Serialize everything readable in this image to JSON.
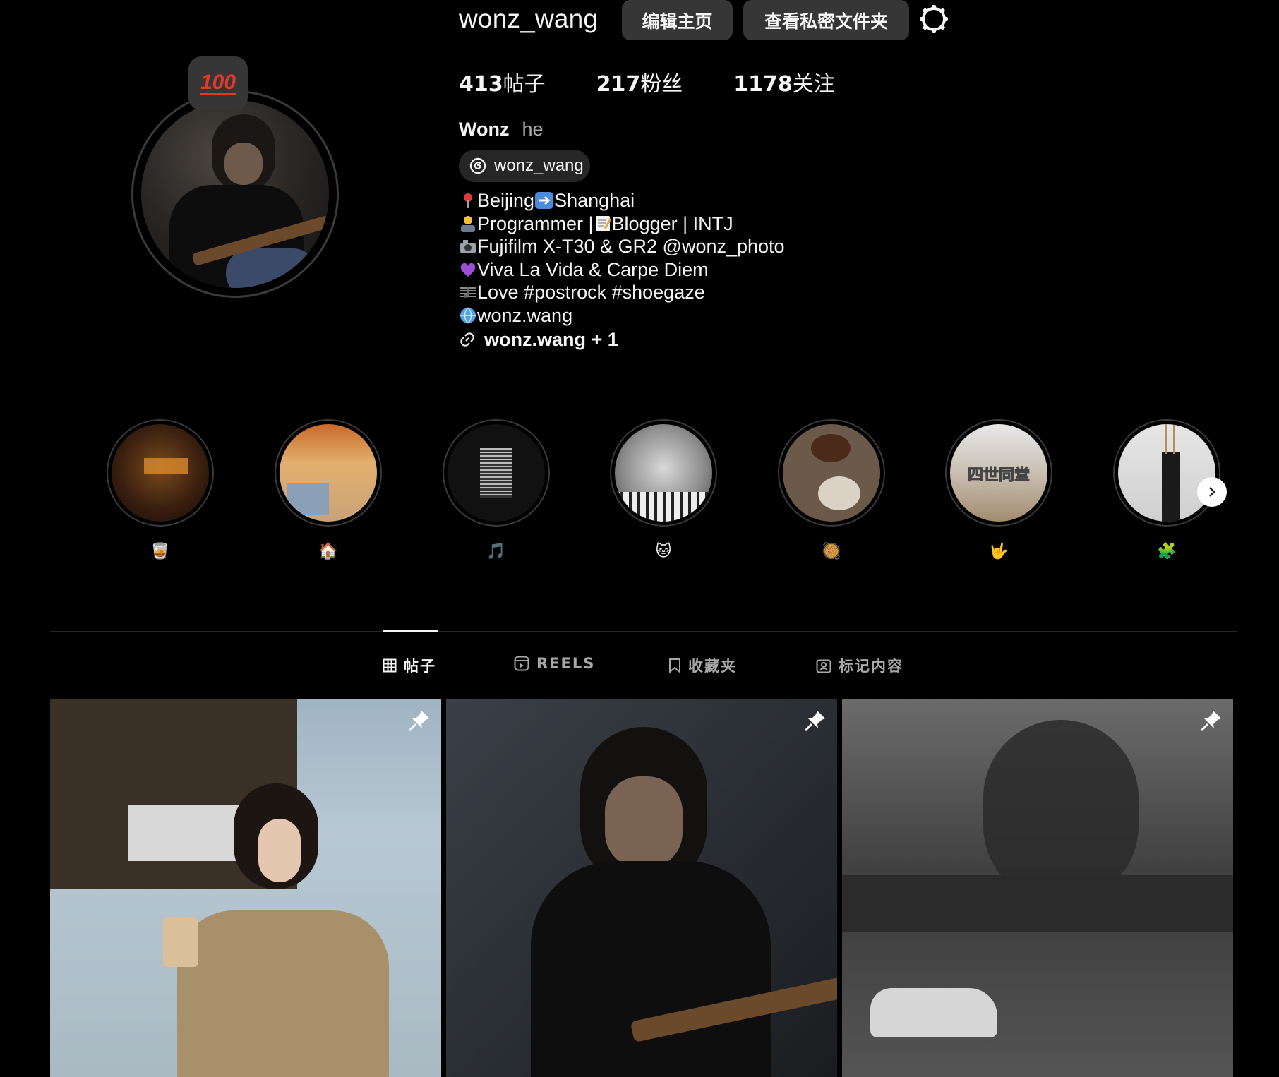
{
  "header": {
    "username": "wonz_wang",
    "edit_profile": "编辑主页",
    "view_private": "查看私密文件夹"
  },
  "stats": {
    "posts": "413",
    "posts_label": "帖子",
    "followers": "217",
    "followers_label": "粉丝",
    "following": "1178",
    "following_label": "关注"
  },
  "profile": {
    "display_name": "Wonz",
    "pronoun": "he",
    "threads_handle": "wonz_wang",
    "note": "100",
    "bio": [
      {
        "text": "Beijing",
        "text2": "Shanghai"
      },
      {
        "text": "Programmer | ",
        "text2": "Blogger | INTJ"
      },
      {
        "text": "Fujifilm X-T30 & GR2 @wonz_photo"
      },
      {
        "text": "Viva La Vida & Carpe Diem"
      },
      {
        "text": "Love #postrock #shoegaze"
      },
      {
        "text": "wonz.wang"
      }
    ],
    "link": "wonz.wang + 1"
  },
  "highlights": [
    {
      "label": "🥃"
    },
    {
      "label": "🏠"
    },
    {
      "label": "🎵"
    },
    {
      "label": "🐱"
    },
    {
      "label": "🥘"
    },
    {
      "label": "🤟",
      "overlay_text": "四世同堂"
    },
    {
      "label": "🧩"
    }
  ],
  "tabs": {
    "posts": "帖子",
    "reels": "REELS",
    "saved": "收藏夹",
    "tagged": "标记内容"
  },
  "colors": {
    "background": "#000000",
    "button": "#363636",
    "text": "#f5f5f5",
    "muted": "#a8a8a8"
  }
}
